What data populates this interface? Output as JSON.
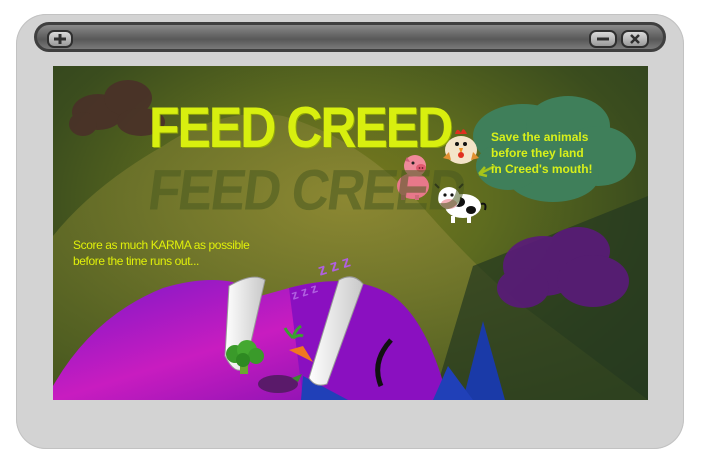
{
  "window": {
    "menu_icon": "plus-icon",
    "minimize_icon": "minus-icon",
    "close_icon": "x-icon"
  },
  "game": {
    "title": "FEED CREED",
    "title_reflection": "FEED CREED",
    "instructions_line1": "Score as much KARMA as possible",
    "instructions_line2": "before the time runs out...",
    "bubble_line1": "Save the animals",
    "bubble_line2": "before they land",
    "bubble_line3": "in Creed's mouth!",
    "zzz_text": "z z z",
    "colors": {
      "title": "#d8ef0f",
      "text": "#e0f00a",
      "creed": "#9a18c8",
      "speech_bubble": "#3f7f5a"
    }
  }
}
